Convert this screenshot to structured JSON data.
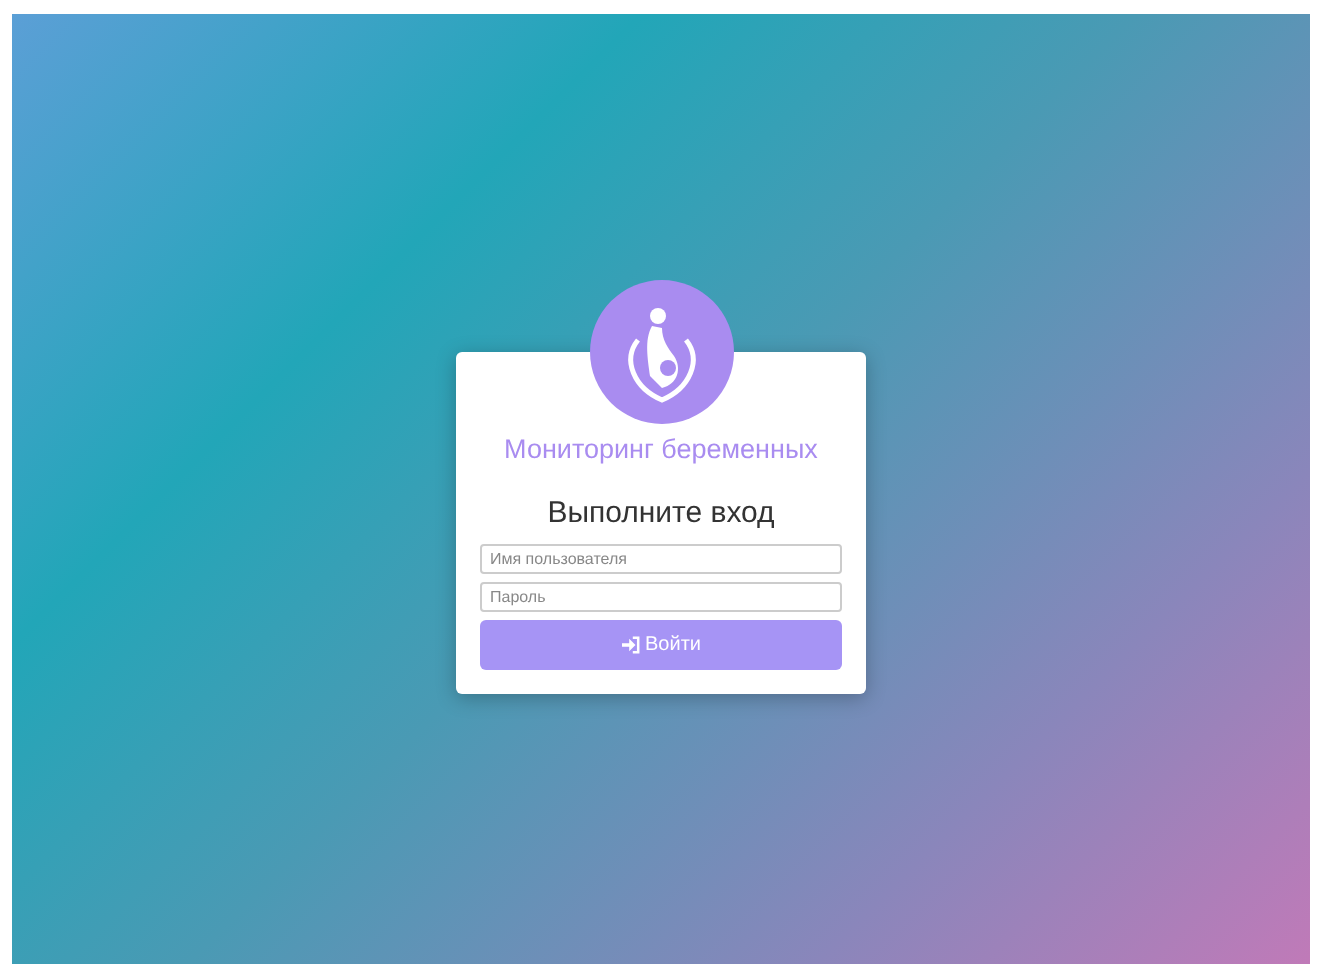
{
  "app_title": "Мониторинг беременных",
  "form_title": "Выполните вход",
  "username_field": {
    "placeholder": "Имя пользователя"
  },
  "password_field": {
    "placeholder": "Пароль"
  },
  "login_button": {
    "label": "Войти"
  }
}
